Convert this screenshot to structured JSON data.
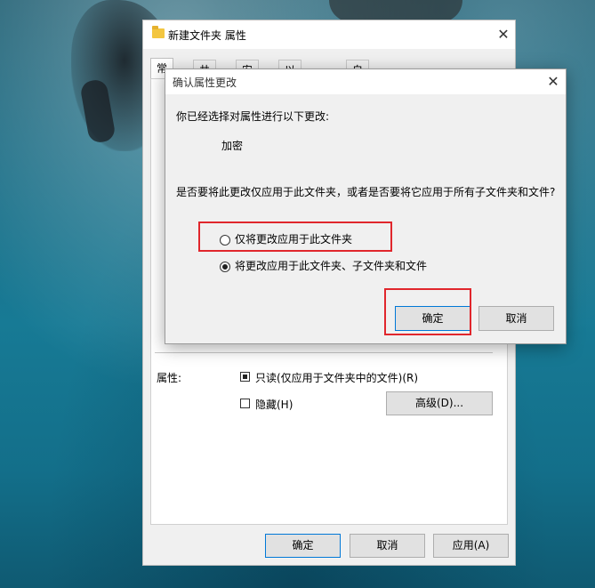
{
  "properties_window": {
    "title": "新建文件夹 属性",
    "tabs": [
      "常规",
      "共享",
      "安全",
      "以前的版本",
      "自定义"
    ],
    "attributes_label": "属性:",
    "readonly_label": "只读(仅应用于文件夹中的文件)(R)",
    "hidden_label": "隐藏(H)",
    "advanced_button": "高级(D)...",
    "ok_button": "确定",
    "cancel_button": "取消",
    "apply_button": "应用(A)"
  },
  "confirm_dialog": {
    "title": "确认属性更改",
    "intro": "你已经选择对属性进行以下更改:",
    "change_item": "加密",
    "question": "是否要将此更改仅应用于此文件夹，或者是否要将它应用于所有子文件夹和文件?",
    "options": [
      {
        "label": "仅将更改应用于此文件夹",
        "selected": false
      },
      {
        "label": "将更改应用于此文件夹、子文件夹和文件",
        "selected": true
      }
    ],
    "ok_button": "确定",
    "cancel_button": "取消"
  },
  "colors": {
    "highlight": "#e0262c",
    "dialog_bg": "#f0f0f0",
    "accent": "#0078d7"
  }
}
